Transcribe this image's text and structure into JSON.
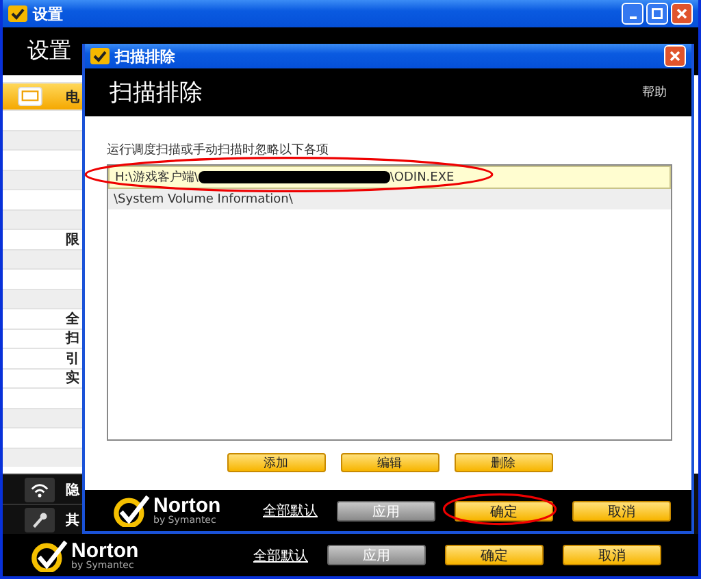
{
  "main_window": {
    "title": "设置",
    "header": "设置",
    "sidebar": [
      {
        "kind": "icon_item",
        "label": "电",
        "selected": true
      },
      {
        "kind": "blank"
      },
      {
        "kind": "blank"
      },
      {
        "kind": "blank"
      },
      {
        "kind": "blank"
      },
      {
        "kind": "blank"
      },
      {
        "kind": "blank"
      },
      {
        "kind": "item",
        "label": "限",
        "selected": false
      },
      {
        "kind": "blank"
      },
      {
        "kind": "blank"
      },
      {
        "kind": "blank"
      },
      {
        "kind": "item",
        "label": "全",
        "selected": false
      },
      {
        "kind": "item",
        "label": "扫",
        "selected": false
      },
      {
        "kind": "item",
        "label": "引",
        "selected": false
      },
      {
        "kind": "item",
        "label": "实",
        "selected": false
      },
      {
        "kind": "blank"
      },
      {
        "kind": "blank"
      },
      {
        "kind": "blank"
      },
      {
        "kind": "blank"
      }
    ],
    "bottom_items": [
      {
        "label": "隐"
      },
      {
        "label": "其"
      }
    ],
    "footer": {
      "logo": "Norton",
      "logo_sub": "by Symantec",
      "link": "全部默认",
      "buttons": [
        {
          "label": "应用",
          "disabled": true
        },
        {
          "label": "确定",
          "disabled": false
        },
        {
          "label": "取消",
          "disabled": false
        }
      ]
    }
  },
  "dialog": {
    "title": "扫描排除",
    "header": "扫描排除",
    "help": "帮助",
    "instruction": "运行调度扫描或手动扫描时忽略以下各项",
    "rows": [
      {
        "prefix": "H:\\游戏客户端\\",
        "redacted": true,
        "suffix": "\\ODIN.EXE",
        "selected": true
      },
      {
        "prefix": "\\System Volume Information\\",
        "redacted": false,
        "selected": false
      }
    ],
    "actions": [
      "添加",
      "编辑",
      "删除"
    ],
    "footer": {
      "logo": "Norton",
      "logo_sub": "by Symantec",
      "link": "全部默认",
      "buttons": [
        {
          "label": "应用",
          "disabled": true
        },
        {
          "label": "确定",
          "disabled": false
        },
        {
          "label": "取消",
          "disabled": false
        }
      ]
    }
  },
  "annotations": [
    {
      "kind": "ellipse"
    },
    {
      "kind": "ellipse"
    }
  ]
}
